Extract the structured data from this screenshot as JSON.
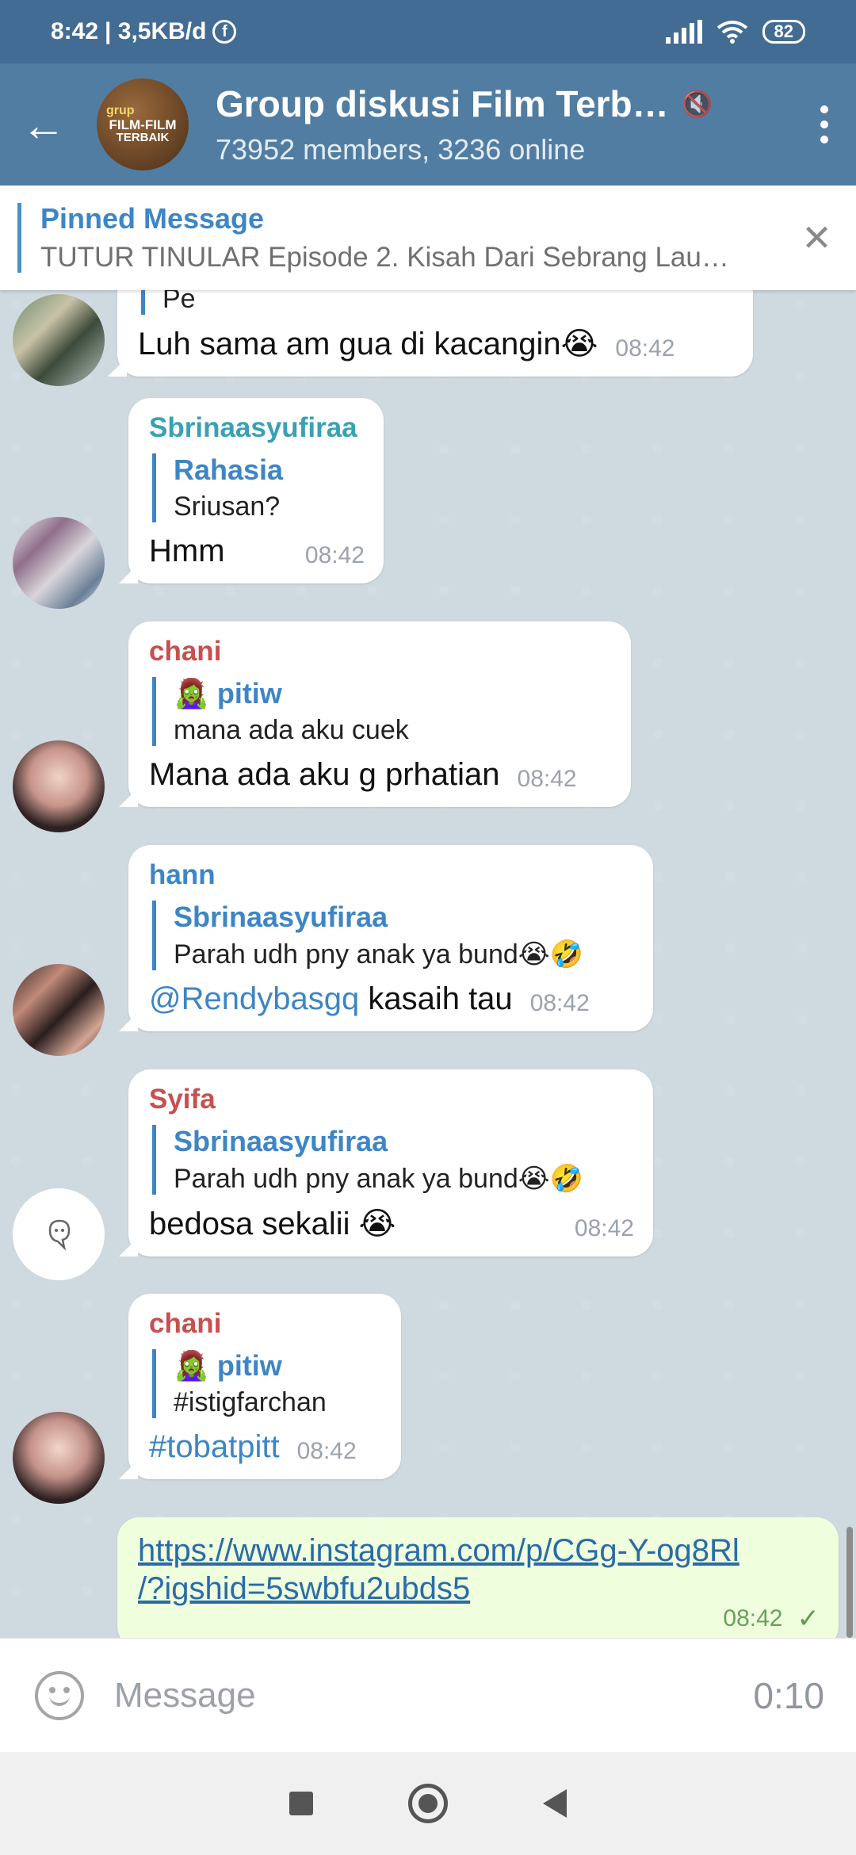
{
  "status_bar": {
    "time": "8:42",
    "data_rate": "| 3,5KB/d",
    "fb_glyph": "f",
    "battery": "82"
  },
  "header": {
    "back_glyph": "←",
    "avatar_line1": "grup",
    "avatar_line2": "FILM-FILM",
    "avatar_line3": "TERBAIK",
    "title": "Group diskusi Film Terb…",
    "subtitle": "73952 members, 3236 online",
    "mute_glyph": "🔇"
  },
  "pinned": {
    "label": "Pinned Message",
    "text": "TUTUR TINULAR Episode 2. Kisah Dari Sebrang Lau…",
    "close_glyph": "✕"
  },
  "messages": [
    {
      "reply_name": "Pe",
      "text": "Luh sama am gua di kacangin😭",
      "time": "08:42"
    },
    {
      "sender": "Sbrinaasyufiraa",
      "sender_color": "#3aa1b3",
      "reply_name": "Rahasia",
      "reply_text": "Sriusan?",
      "text": "Hmm",
      "time": "08:42"
    },
    {
      "sender": "chani",
      "sender_color": "#c84f4f",
      "reply_name": "🧟‍♀️ pitiw",
      "reply_text": "mana ada aku cuek",
      "text": "Mana ada aku g prhatian",
      "time": "08:42"
    },
    {
      "sender": "hann",
      "sender_color": "#3d85c6",
      "reply_name": "Sbrinaasyufiraa",
      "reply_text": "Parah udh pny anak ya bund😭🤣",
      "mention": "@Rendybasgq",
      "text": " kasaih tau",
      "time": "08:42"
    },
    {
      "sender": "Syifa",
      "sender_color": "#c84f4f",
      "reply_name": "Sbrinaasyufiraa",
      "reply_text": "Parah udh pny anak ya bund😭🤣",
      "text": "bedosa sekalii 😭",
      "time": "08:42"
    },
    {
      "sender": "chani",
      "sender_color": "#c84f4f",
      "reply_name": "🧟‍♀️ pitiw",
      "reply_text": "#istigfarchan",
      "hashtag": "#tobatpitt",
      "time": "08:42"
    }
  ],
  "outgoing": {
    "link_line1": "https://www.instagram.com/p/CGg-Y-og8Rl",
    "link_line2": "/?igshid=5swbfu2ubds5",
    "time": "08:42",
    "check": "✓"
  },
  "input": {
    "placeholder": "Message",
    "timer": "0:10"
  },
  "colors": {
    "header": "#517da2",
    "status_bar": "#436c94",
    "accent": "#3d85c6",
    "outgoing_bubble": "#effedd"
  }
}
